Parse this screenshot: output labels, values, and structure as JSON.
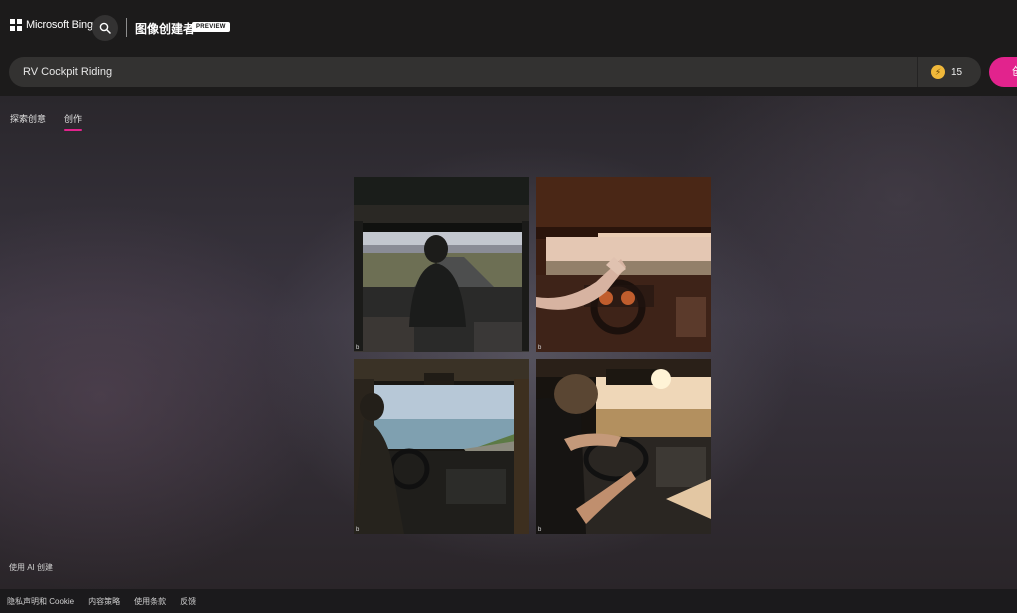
{
  "header": {
    "logo_text": "Microsoft Bing",
    "product_title": "图像创建者",
    "preview_badge": "PREVIEW"
  },
  "prompt": {
    "value": "RV Cockpit Riding",
    "boost_count": "15",
    "create_label": "创"
  },
  "tabs": [
    {
      "label": "探索创意",
      "active": false
    },
    {
      "label": "创作",
      "active": true
    }
  ],
  "images": [
    {
      "name": "rv-cockpit-image-1",
      "mark": "b"
    },
    {
      "name": "rv-cockpit-image-2",
      "mark": "b"
    },
    {
      "name": "rv-cockpit-image-3",
      "mark": "b"
    },
    {
      "name": "rv-cockpit-image-4",
      "mark": "b"
    }
  ],
  "ai_note": "使用 AI 创建",
  "footer": {
    "links": [
      "隐私声明和 Cookie",
      "内容策略",
      "使用条款",
      "反馈"
    ]
  },
  "colors": {
    "accent": "#e2238d",
    "header_bg": "#1c1b1b",
    "prompt_bg": "#333231",
    "coin": "#f0b83a"
  },
  "icons": [
    "windows-logo-icon",
    "search-icon",
    "coin-icon"
  ]
}
